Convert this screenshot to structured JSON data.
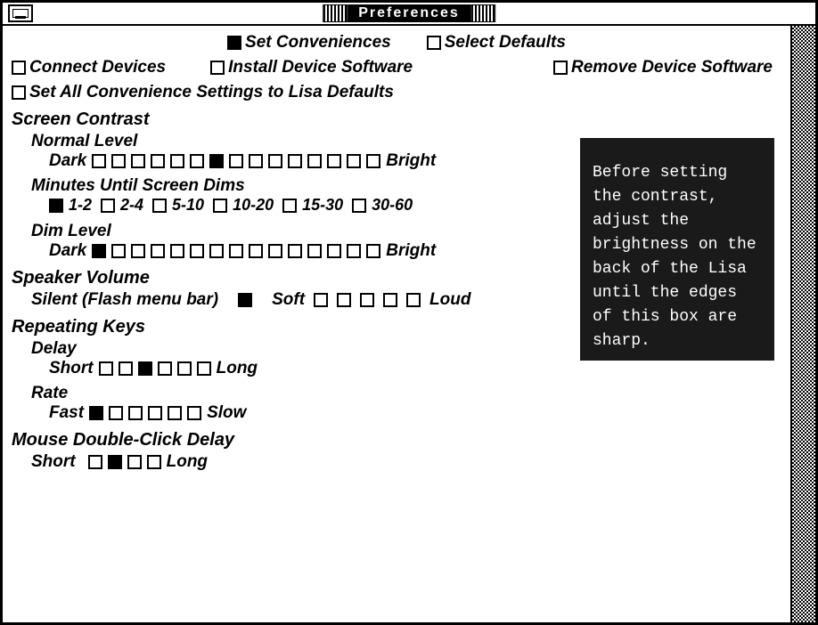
{
  "window": {
    "title": "Preferences"
  },
  "topTabs": {
    "setConveniences": "Set Conveniences",
    "selectDefaults": "Select Defaults"
  },
  "deviceRow": {
    "connect": "Connect Devices",
    "install": "Install Device Software",
    "remove": "Remove Device Software"
  },
  "resetRow": {
    "label": "Set All Convenience Settings to Lisa Defaults"
  },
  "screenContrast": {
    "title": "Screen Contrast",
    "normal": {
      "title": "Normal Level",
      "left": "Dark",
      "right": "Bright",
      "count": 15,
      "selected": 6
    },
    "minutes": {
      "title": "Minutes Until Screen Dims",
      "options": [
        "1-2",
        "2-4",
        "5-10",
        "10-20",
        "15-30",
        "30-60"
      ],
      "selected": 0
    },
    "dim": {
      "title": "Dim Level",
      "left": "Dark",
      "right": "Bright",
      "count": 15,
      "selected": 0
    }
  },
  "speaker": {
    "title": "Speaker Volume",
    "silentLabel": "Silent (Flash menu bar)",
    "soft": "Soft",
    "loud": "Loud",
    "silentSelected": true,
    "softLoudCount": 5,
    "softLoudSelected": -1
  },
  "repeating": {
    "title": "Repeating Keys",
    "delay": {
      "title": "Delay",
      "left": "Short",
      "right": "Long",
      "count": 6,
      "selected": 2
    },
    "rate": {
      "title": "Rate",
      "left": "Fast",
      "right": "Slow",
      "count": 6,
      "selected": 0
    }
  },
  "mouse": {
    "title": "Mouse Double-Click Delay",
    "left": "Short",
    "right": "Long",
    "count": 4,
    "selected": 1
  },
  "help": {
    "text": "Before setting the contrast, adjust the brightness on the back of the Lisa until the edges of this box are sharp."
  }
}
